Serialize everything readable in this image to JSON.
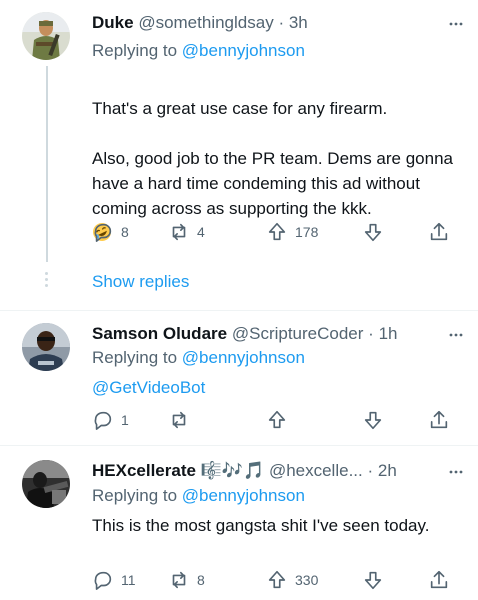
{
  "tweets": [
    {
      "name": "Duke",
      "handle": "@somethingldsay",
      "dot": "·",
      "time": "3h",
      "replying_prefix": "Replying to",
      "replying_to": "@bennyjohnson",
      "text": "That's a great use case for any firearm.\n\nAlso, good job to the PR team. Dems are gonna have a hard time condeming this ad without coming across as supporting the kkk.",
      "emoji": "rolling-on-floor-laughing-emoji",
      "replies": "8",
      "retweets": "4",
      "likes": "178"
    },
    {
      "name": "Samson Oludare",
      "handle": "@ScriptureCoder",
      "dot": "·",
      "time": "1h",
      "replying_prefix": "Replying to",
      "replying_to": "@bennyjohnson",
      "text": "@GetVideoBot",
      "replies": "1",
      "retweets": "",
      "likes": ""
    },
    {
      "name": "HEXcellerate",
      "name_emoji": "🎼🎶🎵",
      "handle": "@hexcelle...",
      "dot": "·",
      "time": "2h",
      "replying_prefix": "Replying to",
      "replying_to": "@bennyjohnson",
      "text": "This is the most gangsta shit I've seen today.",
      "replies": "11",
      "retweets": "8",
      "likes": "330"
    }
  ],
  "show_replies": "Show replies",
  "icons": {
    "reply": "reply-icon",
    "retweet": "retweet-icon",
    "upvote": "upvote-icon",
    "downvote": "downvote-icon",
    "share": "share-icon",
    "more": "more-icon"
  },
  "colors": {
    "accent": "#1d9bf0",
    "secondary_text": "#536471",
    "primary_text": "#0f1419"
  }
}
